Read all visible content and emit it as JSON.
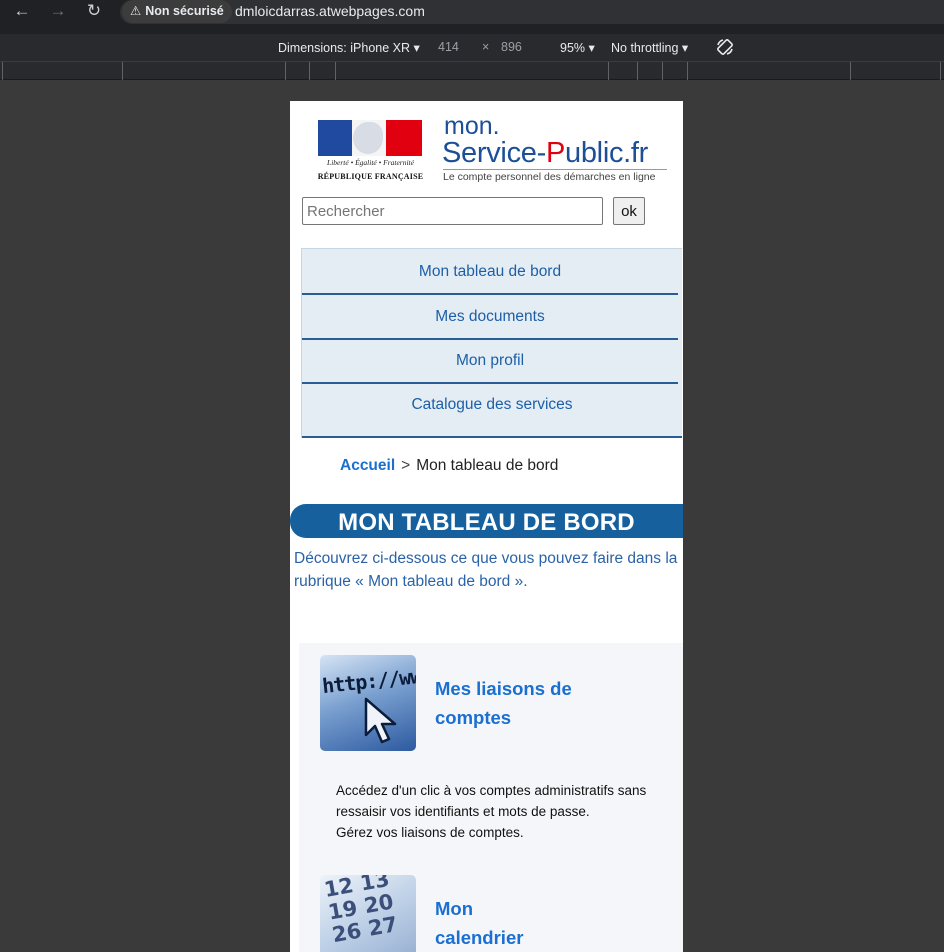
{
  "browser": {
    "security_label": "Non sécurisé",
    "url": "dmloicdarras.atwebpages.com",
    "device_label": "Dimensions: iPhone XR",
    "width": "414",
    "times": "×",
    "height": "896",
    "zoom": "95%",
    "throttling": "No throttling"
  },
  "header": {
    "devise": "Liberté • Égalité • Fraternité",
    "republique": "RÉPUBLIQUE FRANÇAISE",
    "brand_mon": "mon.",
    "brand_service": "Service-",
    "brand_p": "P",
    "brand_rest": "ublic.fr",
    "tagline": "Le compte personnel des démarches en ligne"
  },
  "search": {
    "placeholder": "Rechercher",
    "button": "ok"
  },
  "menu": {
    "items": [
      {
        "label": "Mon tableau de bord"
      },
      {
        "label": "Mes documents"
      },
      {
        "label": "Mon profil"
      },
      {
        "label": "Catalogue des services"
      }
    ]
  },
  "breadcrumb": {
    "home": "Accueil",
    "separator": ">",
    "current": "Mon tableau de bord"
  },
  "page": {
    "title": "MON TABLEAU DE BORD",
    "intro": "Découvrez ci-dessous ce que vous pouvez faire dans la rubrique « Mon tableau de bord »."
  },
  "cards": [
    {
      "title_line1": "Mes liaisons de",
      "title_line2": "comptes",
      "image_text": "http://ww",
      "desc_line1": "Accédez d'un clic à vos comptes administratifs sans",
      "desc_line2": "ressaisir vos identifiants et mots de passe.",
      "desc_line3": "Gérez vos liaisons de comptes."
    },
    {
      "title_line1": "Mon",
      "title_line2": "calendrier",
      "image_text": "12 13\n19 20\n26 27"
    }
  ]
}
